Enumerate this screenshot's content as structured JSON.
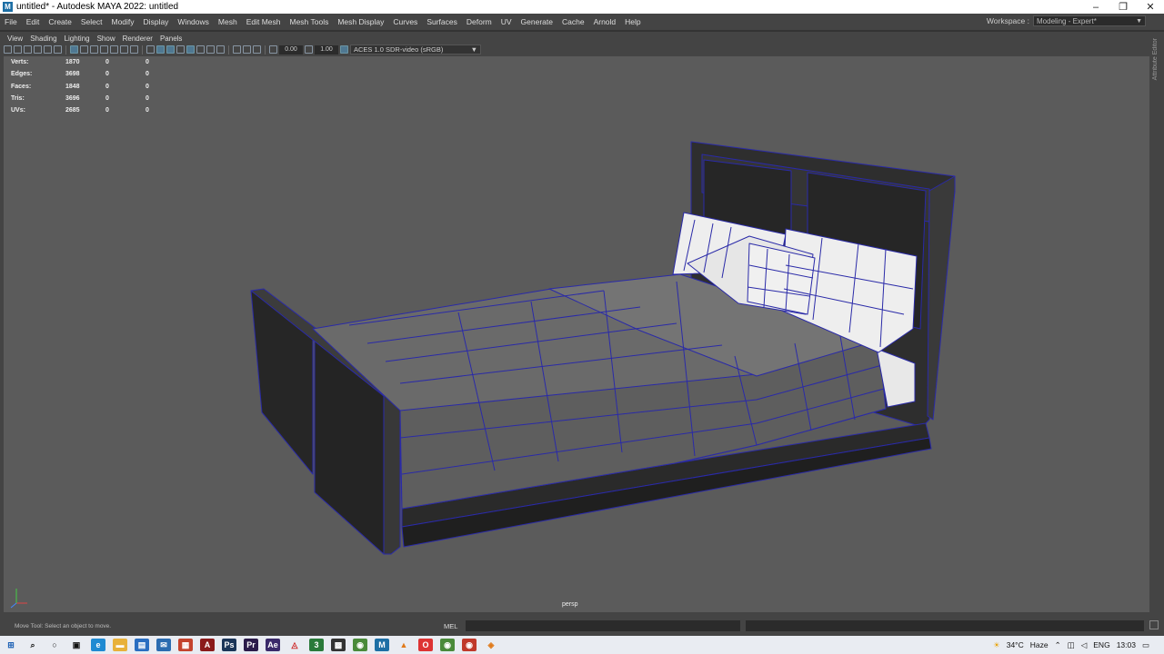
{
  "window": {
    "title": "untitled* - Autodesk MAYA 2022: untitled",
    "app_icon": "M"
  },
  "menubar": {
    "items": [
      "File",
      "Edit",
      "Create",
      "Select",
      "Modify",
      "Display",
      "Windows",
      "Mesh",
      "Edit Mesh",
      "Mesh Tools",
      "Mesh Display",
      "Curves",
      "Surfaces",
      "Deform",
      "UV",
      "Generate",
      "Cache",
      "Arnold",
      "Help"
    ],
    "workspace_label": "Workspace :",
    "workspace_value": "Modeling - Expert*"
  },
  "panel_menu": [
    "View",
    "Shading",
    "Lighting",
    "Show",
    "Renderer",
    "Panels"
  ],
  "toolbar": {
    "exposure": "0.00",
    "gamma": "1.00",
    "color_space": "ACES 1.0 SDR-video (sRGB)"
  },
  "hud": {
    "rows": [
      {
        "label": "Verts:",
        "v1": "1870",
        "v2": "0",
        "v3": "0"
      },
      {
        "label": "Edges:",
        "v1": "3698",
        "v2": "0",
        "v3": "0"
      },
      {
        "label": "Faces:",
        "v1": "1848",
        "v2": "0",
        "v3": "0"
      },
      {
        "label": "Tris:",
        "v1": "3696",
        "v2": "0",
        "v3": "0"
      },
      {
        "label": "UVs:",
        "v1": "2685",
        "v2": "0",
        "v3": "0"
      }
    ]
  },
  "viewport": {
    "camera": "persp"
  },
  "attr_strip": {
    "label": "Attribute Editor"
  },
  "helpline": {
    "text": "Move Tool: Select an object to move.",
    "mel": "MEL"
  },
  "taskbar": {
    "weather": "34°C",
    "weather_desc": "Haze",
    "language": "ENG",
    "time": "13:03"
  },
  "colors": {
    "wireframe": "#2a2aa8",
    "viewport_bg": "#5b5b5b",
    "ui_bg": "#444444"
  }
}
